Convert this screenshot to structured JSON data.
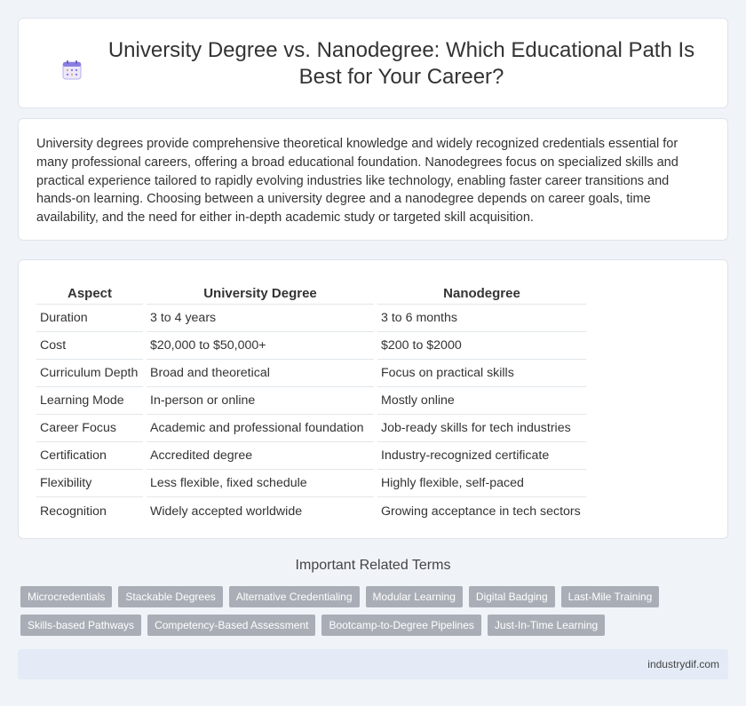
{
  "header": {
    "icon": "calendar-icon",
    "title": "University Degree vs. Nanodegree: Which Educational Path Is Best for Your Career?"
  },
  "intro": {
    "text": "University degrees provide comprehensive theoretical knowledge and widely recognized credentials essential for many professional careers, offering a broad educational foundation. Nanodegrees focus on specialized skills and practical experience tailored to rapidly evolving industries like technology, enabling faster career transitions and hands-on learning. Choosing between a university degree and a nanodegree depends on career goals, time availability, and the need for either in-depth academic study or targeted skill acquisition."
  },
  "table": {
    "headers": [
      "Aspect",
      "University Degree",
      "Nanodegree"
    ],
    "rows": [
      [
        "Duration",
        "3 to 4 years",
        "3 to 6 months"
      ],
      [
        "Cost",
        "$20,000 to $50,000+",
        "$200 to $2000"
      ],
      [
        "Curriculum Depth",
        "Broad and theoretical",
        "Focus on practical skills"
      ],
      [
        "Learning Mode",
        "In-person or online",
        "Mostly online"
      ],
      [
        "Career Focus",
        "Academic and professional foundation",
        "Job-ready skills for tech industries"
      ],
      [
        "Certification",
        "Accredited degree",
        "Industry-recognized certificate"
      ],
      [
        "Flexibility",
        "Less flexible, fixed schedule",
        "Highly flexible, self-paced"
      ],
      [
        "Recognition",
        "Widely accepted worldwide",
        "Growing acceptance in tech sectors"
      ]
    ]
  },
  "related": {
    "title": "Important Related Terms",
    "tags_row1": [
      "Microcredentials",
      "Stackable Degrees",
      "Alternative Credentialing",
      "Modular Learning",
      "Digital Badging",
      "Last-Mile Training"
    ],
    "tags_row2": [
      "Skills-based Pathways",
      "Competency-Based Assessment",
      "Bootcamp-to-Degree Pipelines",
      "Just-In-Time Learning"
    ]
  },
  "footer": {
    "site": "industrydif.com"
  },
  "colors": {
    "background": "#f0f3f8",
    "tag_bg": "#a9aeb6",
    "footer_bg": "#e4ebf6",
    "icon_accent": "#7b6fd0"
  }
}
